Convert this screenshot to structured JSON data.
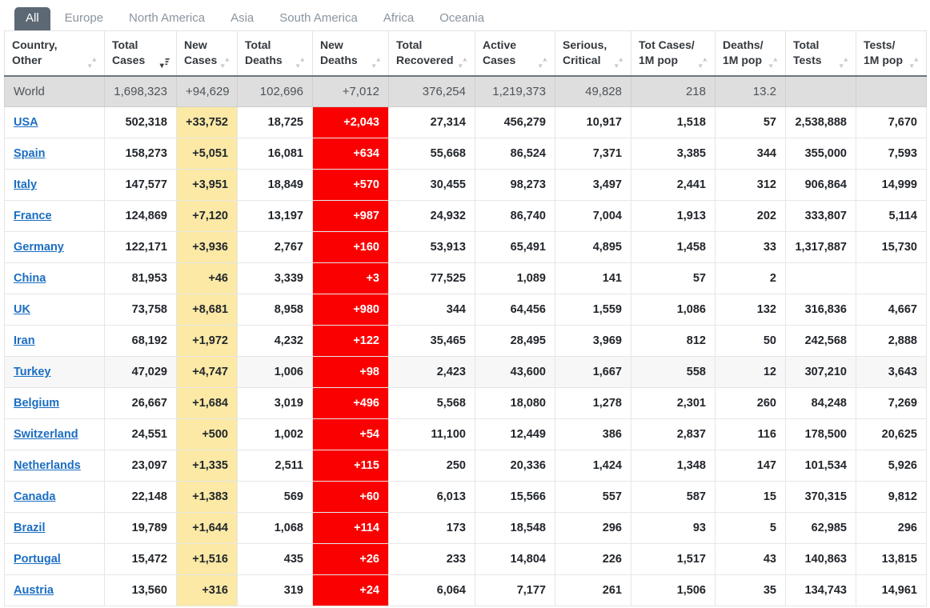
{
  "tabs": [
    {
      "label": "All",
      "active": true
    },
    {
      "label": "Europe",
      "active": false
    },
    {
      "label": "North America",
      "active": false
    },
    {
      "label": "Asia",
      "active": false
    },
    {
      "label": "South America",
      "active": false
    },
    {
      "label": "Africa",
      "active": false
    },
    {
      "label": "Oceania",
      "active": false
    }
  ],
  "colors": {
    "active_tab_bg": "#5c6873",
    "new_cases_bg": "#fbe9a5",
    "new_deaths_bg": "#fb0000",
    "world_row_bg": "#dedede",
    "link": "#1b6ec2",
    "alt_row_bg": "#f7f7f7"
  },
  "table": {
    "columns": [
      {
        "label_line1": "Country,",
        "label_line2": "Other",
        "sort": "sortable",
        "icon": "sort-both-icon",
        "align": "left"
      },
      {
        "label_line1": "Total",
        "label_line2": "Cases",
        "sort": "desc",
        "icon": "sort-desc-icon",
        "align": "right"
      },
      {
        "label_line1": "New",
        "label_line2": "Cases",
        "sort": "sortable",
        "icon": "sort-both-icon",
        "align": "right"
      },
      {
        "label_line1": "Total",
        "label_line2": "Deaths",
        "sort": "sortable",
        "icon": "sort-both-icon",
        "align": "right"
      },
      {
        "label_line1": "New",
        "label_line2": "Deaths",
        "sort": "sortable",
        "icon": "sort-both-icon",
        "align": "right"
      },
      {
        "label_line1": "Total",
        "label_line2": "Recovered",
        "sort": "sortable",
        "icon": "sort-both-icon",
        "align": "right"
      },
      {
        "label_line1": "Active",
        "label_line2": "Cases",
        "sort": "sortable",
        "icon": "sort-both-icon",
        "align": "right"
      },
      {
        "label_line1": "Serious,",
        "label_line2": "Critical",
        "sort": "sortable",
        "icon": "sort-both-icon",
        "align": "right"
      },
      {
        "label_line1": "Tot Cases/",
        "label_line2": "1M pop",
        "sort": "sortable",
        "icon": "sort-both-icon",
        "align": "right"
      },
      {
        "label_line1": "Deaths/",
        "label_line2": "1M pop",
        "sort": "sortable",
        "icon": "sort-both-icon",
        "align": "right"
      },
      {
        "label_line1": "Total",
        "label_line2": "Tests",
        "sort": "sortable",
        "icon": "sort-both-icon",
        "align": "right"
      },
      {
        "label_line1": "Tests/",
        "label_line2": "1M pop",
        "sort": "sortable",
        "icon": "sort-both-icon",
        "align": "right"
      }
    ],
    "world_row": {
      "country": "World",
      "cells": [
        "1,698,323",
        "+94,629",
        "102,696",
        "+7,012",
        "376,254",
        "1,219,373",
        "49,828",
        "218",
        "13.2",
        "",
        ""
      ]
    },
    "rows": [
      {
        "country": "USA",
        "link": true,
        "highlight": false,
        "cells": [
          "502,318",
          "+33,752",
          "18,725",
          "+2,043",
          "27,314",
          "456,279",
          "10,917",
          "1,518",
          "57",
          "2,538,888",
          "7,670"
        ]
      },
      {
        "country": "Spain",
        "link": true,
        "highlight": false,
        "cells": [
          "158,273",
          "+5,051",
          "16,081",
          "+634",
          "55,668",
          "86,524",
          "7,371",
          "3,385",
          "344",
          "355,000",
          "7,593"
        ]
      },
      {
        "country": "Italy",
        "link": true,
        "highlight": false,
        "cells": [
          "147,577",
          "+3,951",
          "18,849",
          "+570",
          "30,455",
          "98,273",
          "3,497",
          "2,441",
          "312",
          "906,864",
          "14,999"
        ]
      },
      {
        "country": "France",
        "link": true,
        "highlight": false,
        "cells": [
          "124,869",
          "+7,120",
          "13,197",
          "+987",
          "24,932",
          "86,740",
          "7,004",
          "1,913",
          "202",
          "333,807",
          "5,114"
        ]
      },
      {
        "country": "Germany",
        "link": true,
        "highlight": false,
        "cells": [
          "122,171",
          "+3,936",
          "2,767",
          "+160",
          "53,913",
          "65,491",
          "4,895",
          "1,458",
          "33",
          "1,317,887",
          "15,730"
        ]
      },
      {
        "country": "China",
        "link": true,
        "highlight": false,
        "cells": [
          "81,953",
          "+46",
          "3,339",
          "+3",
          "77,525",
          "1,089",
          "141",
          "57",
          "2",
          "",
          ""
        ]
      },
      {
        "country": "UK",
        "link": true,
        "highlight": false,
        "cells": [
          "73,758",
          "+8,681",
          "8,958",
          "+980",
          "344",
          "64,456",
          "1,559",
          "1,086",
          "132",
          "316,836",
          "4,667"
        ]
      },
      {
        "country": "Iran",
        "link": true,
        "highlight": false,
        "cells": [
          "68,192",
          "+1,972",
          "4,232",
          "+122",
          "35,465",
          "28,495",
          "3,969",
          "812",
          "50",
          "242,568",
          "2,888"
        ]
      },
      {
        "country": "Turkey",
        "link": true,
        "highlight": true,
        "cells": [
          "47,029",
          "+4,747",
          "1,006",
          "+98",
          "2,423",
          "43,600",
          "1,667",
          "558",
          "12",
          "307,210",
          "3,643"
        ]
      },
      {
        "country": "Belgium",
        "link": true,
        "highlight": false,
        "cells": [
          "26,667",
          "+1,684",
          "3,019",
          "+496",
          "5,568",
          "18,080",
          "1,278",
          "2,301",
          "260",
          "84,248",
          "7,269"
        ]
      },
      {
        "country": "Switzerland",
        "link": true,
        "highlight": false,
        "cells": [
          "24,551",
          "+500",
          "1,002",
          "+54",
          "11,100",
          "12,449",
          "386",
          "2,837",
          "116",
          "178,500",
          "20,625"
        ]
      },
      {
        "country": "Netherlands",
        "link": true,
        "highlight": false,
        "cells": [
          "23,097",
          "+1,335",
          "2,511",
          "+115",
          "250",
          "20,336",
          "1,424",
          "1,348",
          "147",
          "101,534",
          "5,926"
        ]
      },
      {
        "country": "Canada",
        "link": true,
        "highlight": false,
        "cells": [
          "22,148",
          "+1,383",
          "569",
          "+60",
          "6,013",
          "15,566",
          "557",
          "587",
          "15",
          "370,315",
          "9,812"
        ]
      },
      {
        "country": "Brazil",
        "link": true,
        "highlight": false,
        "cells": [
          "19,789",
          "+1,644",
          "1,068",
          "+114",
          "173",
          "18,548",
          "296",
          "93",
          "5",
          "62,985",
          "296"
        ]
      },
      {
        "country": "Portugal",
        "link": true,
        "highlight": false,
        "cells": [
          "15,472",
          "+1,516",
          "435",
          "+26",
          "233",
          "14,804",
          "226",
          "1,517",
          "43",
          "140,863",
          "13,815"
        ]
      },
      {
        "country": "Austria",
        "link": true,
        "highlight": false,
        "cells": [
          "13,560",
          "+316",
          "319",
          "+24",
          "6,064",
          "7,177",
          "261",
          "1,506",
          "35",
          "134,743",
          "14,961"
        ]
      }
    ]
  }
}
